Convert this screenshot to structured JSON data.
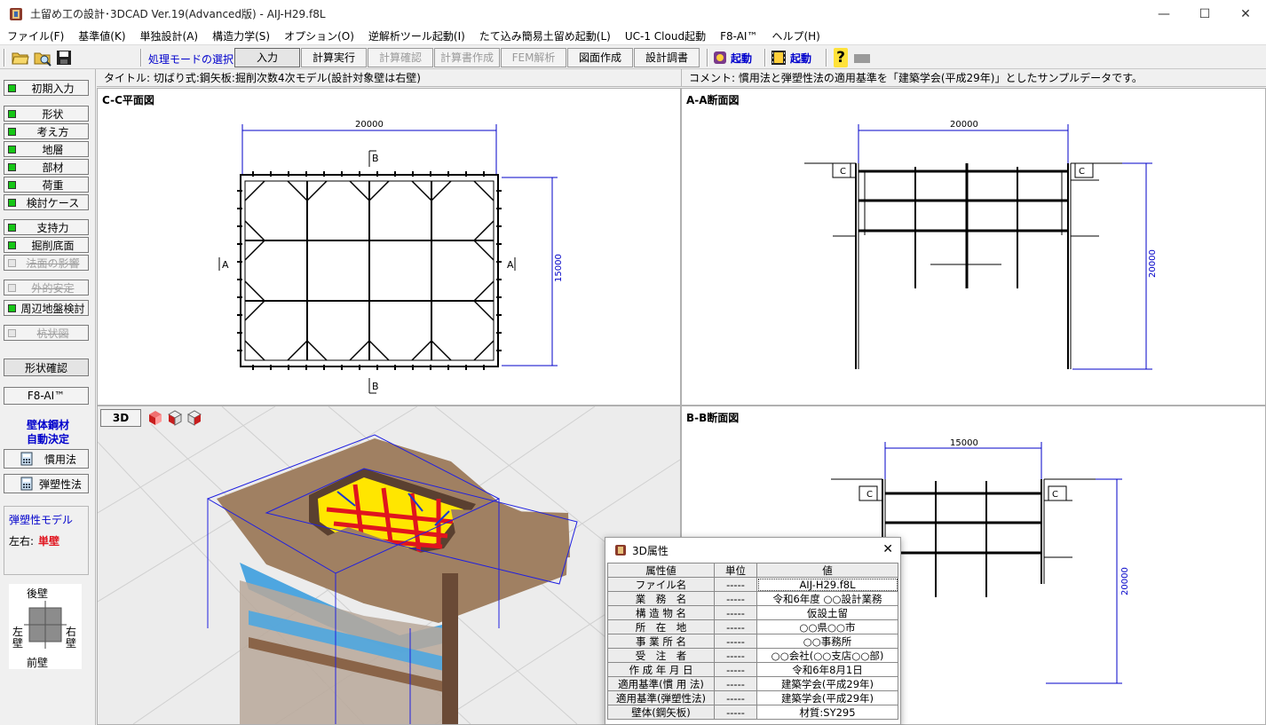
{
  "window": {
    "title": "土留め工の設計･3DCAD Ver.19(Advanced版) - AIJ-H29.f8L",
    "minimize": "—",
    "maximize": "☐",
    "close": "✕"
  },
  "menu": [
    "ファイル(F)",
    "基準値(K)",
    "単独設計(A)",
    "構造力学(S)",
    "オプション(O)",
    "逆解析ツール起動(I)",
    "たて込み簡易土留め起動(L)",
    "UC-1 Cloud起動",
    "F8-AI™",
    "ヘルプ(H)"
  ],
  "toolbar": {
    "mode_label": "処理モードの選択",
    "buttons": [
      {
        "label": "入力",
        "enabled": true
      },
      {
        "label": "計算実行",
        "enabled": true
      },
      {
        "label": "計算確認",
        "enabled": false
      },
      {
        "label": "計算書作成",
        "enabled": false
      },
      {
        "label": "FEM解析",
        "enabled": false
      },
      {
        "label": "図面作成",
        "enabled": true
      },
      {
        "label": "設計調書",
        "enabled": true
      }
    ],
    "launch1": "起動",
    "launch2": "起動",
    "help": "?"
  },
  "sidebar": {
    "initial": "初期入力",
    "group1": [
      "形状",
      "考え方",
      "地層",
      "部材",
      "荷重",
      "検討ケース"
    ],
    "group2": [
      "支持力",
      "掘削底面"
    ],
    "disabled1": "法面の影響",
    "disabled2": "外的安定",
    "surround": "周辺地盤検討",
    "disabled3": "杭状図",
    "shape_check": "形状確認",
    "f8ai": "F8-AI™",
    "auto_line1": "壁体鋼材",
    "auto_line2": "自動決定",
    "method1": "慣用法",
    "method2": "弾塑性法",
    "model_title": "弾塑性モデル",
    "model_label": "左右:",
    "model_value": "単壁",
    "compass": {
      "back": "後壁",
      "front": "前壁",
      "left1": "左",
      "left2": "壁",
      "right1": "右",
      "right2": "壁"
    }
  },
  "headers": {
    "title": "タイトル: 切ばり式:鋼矢板:掘削次数4次モデル(設計対象壁は右壁)",
    "comment": "コメント: 慣用法と弾塑性法の適用基準を「建築学会(平成29年)」としたサンプルデータです。"
  },
  "panes": {
    "plan": {
      "title": "C-C平面図",
      "dim_w": "20000",
      "dim_h": "15000",
      "sec_a": "A",
      "sec_b": "B"
    },
    "aa": {
      "title": "A-A断面図",
      "dim_w": "20000",
      "dim_h": "20000",
      "sec_c": "C"
    },
    "bb": {
      "title": "B-B断面図",
      "dim_w": "15000",
      "dim_h": "20000",
      "sec_c": "C"
    },
    "view3d": {
      "button": "3D"
    }
  },
  "dialog": {
    "title": "3D属性",
    "close": "✕",
    "header": [
      "属性値",
      "単位",
      "値"
    ],
    "rows": [
      [
        "ファイル名",
        "-----",
        "AIJ-H29.f8L"
      ],
      [
        "業　務　名",
        "-----",
        "令和6年度 ○○設計業務"
      ],
      [
        "構 造 物 名",
        "-----",
        "仮設土留"
      ],
      [
        "所　在　地",
        "-----",
        "○○県○○市"
      ],
      [
        "事 業 所 名",
        "-----",
        "○○事務所"
      ],
      [
        "受　注　者",
        "-----",
        "○○会社(○○支店○○部)"
      ],
      [
        "作 成 年 月 日",
        "-----",
        "令和6年8月1日"
      ],
      [
        "適用基準(慣 用 法)",
        "-----",
        "建築学会(平成29年)"
      ],
      [
        "適用基準(弾塑性法)",
        "-----",
        "建築学会(平成29年)"
      ],
      [
        "壁体(鋼矢板)",
        "-----",
        "材質:SY295"
      ]
    ]
  },
  "colors": {
    "accent": "#0000cc",
    "led": "#16c716",
    "dim": "#0000c8",
    "strut": "#e0141e",
    "wale": "#ffe600"
  }
}
